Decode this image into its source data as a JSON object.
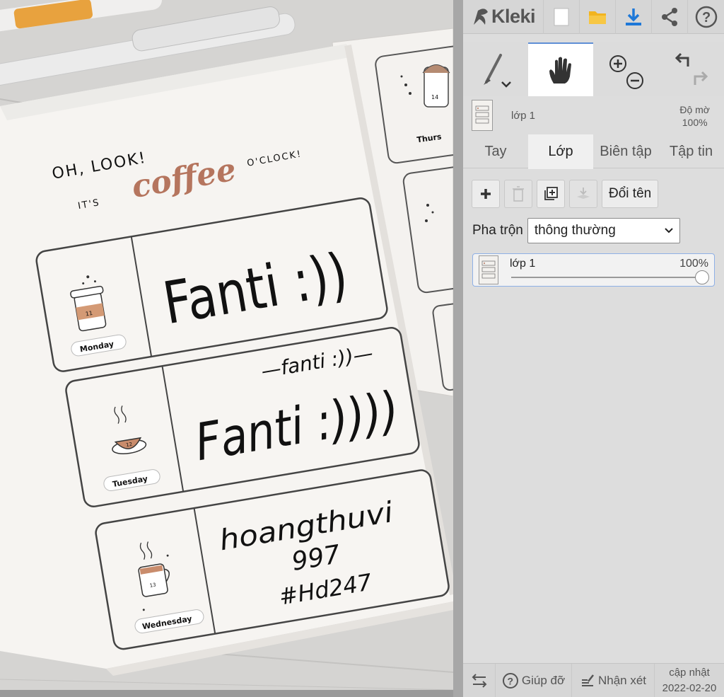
{
  "app": {
    "name": "Kleki"
  },
  "canvas": {
    "header_line1": "OH, LOOK!",
    "header_its": "IT'S",
    "header_coffee": "coffee",
    "header_oclock": "O'CLOCK!",
    "row1_day": "Monday",
    "row1_text": "Fanti :))",
    "row2_day": "Tuesday",
    "row2_note": "—fanti :))—",
    "row2_text": "Fanti :))))",
    "row3_day": "Wednesday",
    "row3_line1": "hoangthuvi",
    "row3_line2": "997",
    "row3_line3": "#Hd247",
    "cup1_num": "11",
    "cup2_num": "12",
    "cup3_num": "13",
    "page2_cup_num": "14",
    "page2_day": "Thurs"
  },
  "tools": {
    "brush": "brush-tool",
    "hand": "hand-tool",
    "zoom_in": "zoom-in",
    "zoom_out": "zoom-out",
    "undo": "undo",
    "redo": "redo"
  },
  "layer_preview": {
    "name": "lớp 1",
    "opacity_label": "Độ mờ",
    "opacity_value": "100%"
  },
  "tabs": [
    {
      "label": "Tay"
    },
    {
      "label": "Lớp"
    },
    {
      "label": "Biên tập"
    },
    {
      "label": "Tập tin"
    }
  ],
  "layers_panel": {
    "rename_label": "Đổi tên",
    "blend_label": "Pha trộn",
    "blend_value": "thông thường",
    "layers": [
      {
        "name": "lớp 1",
        "opacity": "100%"
      }
    ]
  },
  "bottom_bar": {
    "help_label": "Giúp đỡ",
    "feedback_label": "Nhận xét",
    "update_label": "cập nhật",
    "update_date": "2022-02-20"
  },
  "colors": {
    "accent": "#5f8fd6",
    "download_blue": "#1e78d8",
    "folder_yellow": "#f2b41f",
    "coffee_brown": "#b5755e"
  }
}
